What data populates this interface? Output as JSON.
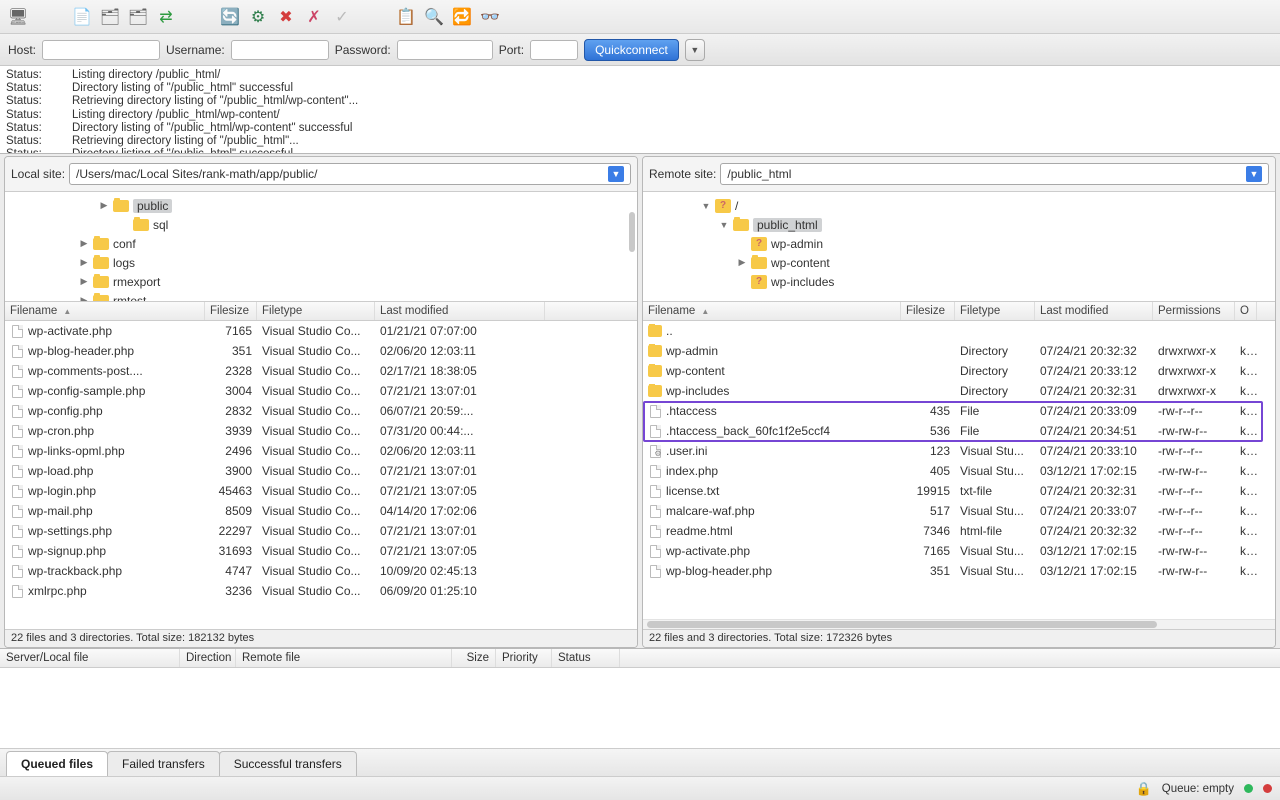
{
  "quickconnect": {
    "host_label": "Host:",
    "username_label": "Username:",
    "password_label": "Password:",
    "port_label": "Port:",
    "button": "Quickconnect"
  },
  "log": [
    {
      "status": "Status:",
      "msg": "Listing directory /public_html/"
    },
    {
      "status": "Status:",
      "msg": "Directory listing of \"/public_html\" successful"
    },
    {
      "status": "Status:",
      "msg": "Retrieving directory listing of \"/public_html/wp-content\"..."
    },
    {
      "status": "Status:",
      "msg": "Listing directory /public_html/wp-content/"
    },
    {
      "status": "Status:",
      "msg": "Directory listing of \"/public_html/wp-content\" successful"
    },
    {
      "status": "Status:",
      "msg": "Retrieving directory listing of \"/public_html\"..."
    },
    {
      "status": "Status:",
      "msg": "Directory listing of \"/public_html\" successful"
    }
  ],
  "local": {
    "site_label": "Local site:",
    "path": "/Users/mac/Local Sites/rank-math/app/public/",
    "tree": [
      {
        "indent": 2,
        "arrow": "▶",
        "label": "public",
        "selected": true
      },
      {
        "indent": 3,
        "arrow": "",
        "label": "sql"
      },
      {
        "indent": 1,
        "arrow": "▶",
        "label": "conf"
      },
      {
        "indent": 1,
        "arrow": "▶",
        "label": "logs"
      },
      {
        "indent": 1,
        "arrow": "▶",
        "label": "rmexport"
      },
      {
        "indent": 1,
        "arrow": "▶",
        "label": "rmtest"
      }
    ],
    "columns": {
      "name": "Filename",
      "size": "Filesize",
      "type": "Filetype",
      "mod": "Last modified"
    },
    "files": [
      {
        "name": "wp-activate.php",
        "size": "7165",
        "type": "Visual Studio Co...",
        "mod": "01/21/21 07:07:00"
      },
      {
        "name": "wp-blog-header.php",
        "size": "351",
        "type": "Visual Studio Co...",
        "mod": "02/06/20 12:03:11"
      },
      {
        "name": "wp-comments-post....",
        "size": "2328",
        "type": "Visual Studio Co...",
        "mod": "02/17/21 18:38:05"
      },
      {
        "name": "wp-config-sample.php",
        "size": "3004",
        "type": "Visual Studio Co...",
        "mod": "07/21/21 13:07:01"
      },
      {
        "name": "wp-config.php",
        "size": "2832",
        "type": "Visual Studio Co...",
        "mod": "06/07/21 20:59:..."
      },
      {
        "name": "wp-cron.php",
        "size": "3939",
        "type": "Visual Studio Co...",
        "mod": "07/31/20 00:44:..."
      },
      {
        "name": "wp-links-opml.php",
        "size": "2496",
        "type": "Visual Studio Co...",
        "mod": "02/06/20 12:03:11"
      },
      {
        "name": "wp-load.php",
        "size": "3900",
        "type": "Visual Studio Co...",
        "mod": "07/21/21 13:07:01"
      },
      {
        "name": "wp-login.php",
        "size": "45463",
        "type": "Visual Studio Co...",
        "mod": "07/21/21 13:07:05"
      },
      {
        "name": "wp-mail.php",
        "size": "8509",
        "type": "Visual Studio Co...",
        "mod": "04/14/20 17:02:06"
      },
      {
        "name": "wp-settings.php",
        "size": "22297",
        "type": "Visual Studio Co...",
        "mod": "07/21/21 13:07:01"
      },
      {
        "name": "wp-signup.php",
        "size": "31693",
        "type": "Visual Studio Co...",
        "mod": "07/21/21 13:07:05"
      },
      {
        "name": "wp-trackback.php",
        "size": "4747",
        "type": "Visual Studio Co...",
        "mod": "10/09/20 02:45:13"
      },
      {
        "name": "xmlrpc.php",
        "size": "3236",
        "type": "Visual Studio Co...",
        "mod": "06/09/20 01:25:10"
      }
    ],
    "status": "22 files and 3 directories. Total size: 182132 bytes"
  },
  "remote": {
    "site_label": "Remote site:",
    "path": "/public_html",
    "tree": [
      {
        "indent": 1,
        "arrow": "▼",
        "folder": "q",
        "label": "/"
      },
      {
        "indent": 2,
        "arrow": "▼",
        "folder": "y",
        "label": "public_html",
        "selected": true
      },
      {
        "indent": 3,
        "arrow": "",
        "folder": "q",
        "label": "wp-admin"
      },
      {
        "indent": 3,
        "arrow": "▶",
        "folder": "y",
        "label": "wp-content"
      },
      {
        "indent": 3,
        "arrow": "",
        "folder": "q",
        "label": "wp-includes"
      }
    ],
    "columns": {
      "name": "Filename",
      "size": "Filesize",
      "type": "Filetype",
      "mod": "Last modified",
      "perm": "Permissions",
      "own": "O"
    },
    "files": [
      {
        "icon": "folder",
        "name": "..",
        "size": "",
        "type": "",
        "mod": "",
        "perm": "",
        "own": ""
      },
      {
        "icon": "folder",
        "name": "wp-admin",
        "size": "",
        "type": "Directory",
        "mod": "07/24/21 20:32:32",
        "perm": "drwxrwxr-x",
        "own": "kh"
      },
      {
        "icon": "folder",
        "name": "wp-content",
        "size": "",
        "type": "Directory",
        "mod": "07/24/21 20:33:12",
        "perm": "drwxrwxr-x",
        "own": "kh"
      },
      {
        "icon": "folder",
        "name": "wp-includes",
        "size": "",
        "type": "Directory",
        "mod": "07/24/21 20:32:31",
        "perm": "drwxrwxr-x",
        "own": "kh"
      },
      {
        "icon": "file",
        "name": ".htaccess",
        "size": "435",
        "type": "File",
        "mod": "07/24/21 20:33:09",
        "perm": "-rw-r--r--",
        "own": "kh"
      },
      {
        "icon": "file",
        "name": ".htaccess_back_60fc1f2e5ccf4",
        "size": "536",
        "type": "File",
        "mod": "07/24/21 20:34:51",
        "perm": "-rw-rw-r--",
        "own": "kh"
      },
      {
        "icon": "gear",
        "name": ".user.ini",
        "size": "123",
        "type": "Visual Stu...",
        "mod": "07/24/21 20:33:10",
        "perm": "-rw-r--r--",
        "own": "kh"
      },
      {
        "icon": "file",
        "name": "index.php",
        "size": "405",
        "type": "Visual Stu...",
        "mod": "03/12/21 17:02:15",
        "perm": "-rw-rw-r--",
        "own": "kh"
      },
      {
        "icon": "file",
        "name": "license.txt",
        "size": "19915",
        "type": "txt-file",
        "mod": "07/24/21 20:32:31",
        "perm": "-rw-r--r--",
        "own": "kh"
      },
      {
        "icon": "file",
        "name": "malcare-waf.php",
        "size": "517",
        "type": "Visual Stu...",
        "mod": "07/24/21 20:33:07",
        "perm": "-rw-r--r--",
        "own": "kh"
      },
      {
        "icon": "file",
        "name": "readme.html",
        "size": "7346",
        "type": "html-file",
        "mod": "07/24/21 20:32:32",
        "perm": "-rw-r--r--",
        "own": "kh"
      },
      {
        "icon": "file",
        "name": "wp-activate.php",
        "size": "7165",
        "type": "Visual Stu...",
        "mod": "03/12/21 17:02:15",
        "perm": "-rw-rw-r--",
        "own": "kh"
      },
      {
        "icon": "file",
        "name": "wp-blog-header.php",
        "size": "351",
        "type": "Visual Stu...",
        "mod": "03/12/21 17:02:15",
        "perm": "-rw-rw-r--",
        "own": "kh"
      }
    ],
    "status": "22 files and 3 directories. Total size: 172326 bytes"
  },
  "queue": {
    "columns": {
      "server": "Server/Local file",
      "dir": "Direction",
      "remote": "Remote file",
      "size": "Size",
      "prio": "Priority",
      "status": "Status"
    }
  },
  "tabs": {
    "queued": "Queued files",
    "failed": "Failed transfers",
    "success": "Successful transfers"
  },
  "bottom": {
    "queue": "Queue: empty"
  }
}
